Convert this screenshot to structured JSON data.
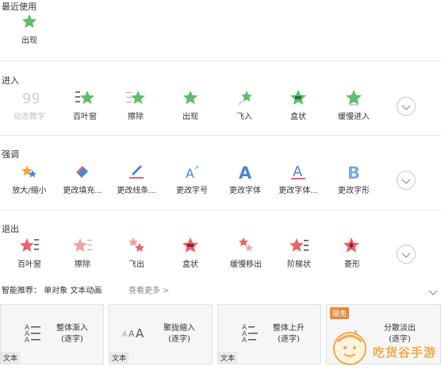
{
  "sections": {
    "recent": {
      "title": "最近使用",
      "items": [
        {
          "label": "出现"
        }
      ]
    },
    "enter": {
      "title": "进入",
      "items": [
        {
          "label": "动态数字"
        },
        {
          "label": "百叶窗"
        },
        {
          "label": "擦除"
        },
        {
          "label": "出现"
        },
        {
          "label": "飞入"
        },
        {
          "label": "盒状"
        },
        {
          "label": "缓慢进入"
        }
      ]
    },
    "emphasis": {
      "title": "强调",
      "items": [
        {
          "label": "放大/缩小"
        },
        {
          "label": "更改填充..."
        },
        {
          "label": "更改线条..."
        },
        {
          "label": "更改字号"
        },
        {
          "label": "更改字体"
        },
        {
          "label": "更改字体..."
        },
        {
          "label": "更改字形"
        }
      ]
    },
    "exit": {
      "title": "退出",
      "items": [
        {
          "label": "百叶窗"
        },
        {
          "label": "擦除"
        },
        {
          "label": "飞出"
        },
        {
          "label": "盒状"
        },
        {
          "label": "缓慢移出"
        },
        {
          "label": "阶梯状"
        },
        {
          "label": "菱形"
        }
      ]
    }
  },
  "smart": {
    "label": "智能推荐：  单对象 文本动画",
    "more": "查看更多 >",
    "cards": [
      {
        "name1": "整体渐入",
        "name2": "(逐字)",
        "tag": "文本",
        "preview": "A—"
      },
      {
        "name1": "聚拢缩入",
        "name2": "(逐字)",
        "tag": "文本",
        "preview": "AAA"
      },
      {
        "name1": "整体上升",
        "name2": "(逐字)",
        "tag": "文本",
        "preview": "A≡"
      },
      {
        "name1": "分散淡出",
        "name2": "(逐字)",
        "badge": "限免",
        "preview": "A"
      }
    ]
  },
  "watermark": {
    "text": "吃货谷手游"
  },
  "colors": {
    "green": "#5cbf6c",
    "red": "#e8636a",
    "blue": "#4a86d8",
    "orange": "#f0a43a"
  }
}
